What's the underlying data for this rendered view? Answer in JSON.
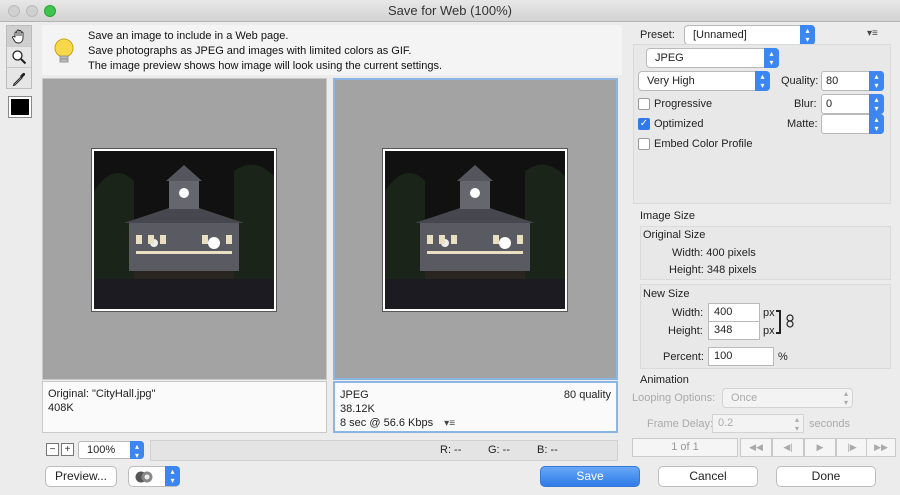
{
  "window": {
    "title": "Save for Web (100%)"
  },
  "colors": {
    "accent": "#2f7ae8",
    "pane_bg": "#a3a3a3",
    "selected_border": "#8db5e3"
  },
  "tools": [
    "hand-icon",
    "zoom-icon",
    "eyedropper-icon"
  ],
  "tip": {
    "lines": [
      "Save an image to include in a Web page.",
      "Save photographs as JPEG and images with limited colors as GIF.",
      "The image preview shows how image will look using the current settings."
    ]
  },
  "original_pane": {
    "name": "Original: \"CityHall.jpg\"",
    "size": "408K"
  },
  "optimized_pane": {
    "format": "JPEG",
    "quality_text": "80 quality",
    "size": "38.12K",
    "download": "8 sec @ 56.6 Kbps"
  },
  "bottom": {
    "zoom": "100%",
    "r": "R: --",
    "g": "G: --",
    "b": "B: --"
  },
  "buttons": {
    "preview": "Preview...",
    "save": "Save",
    "cancel": "Cancel",
    "done": "Done"
  },
  "preset": {
    "label": "Preset:",
    "value": "[Unnamed]"
  },
  "format": {
    "value": "JPEG"
  },
  "quality_level": {
    "value": "Very High"
  },
  "quality": {
    "label": "Quality:",
    "value": "80"
  },
  "blur": {
    "label": "Blur:",
    "value": "0"
  },
  "matte": {
    "label": "Matte:",
    "value": ""
  },
  "options": {
    "progressive": {
      "label": "Progressive",
      "checked": false
    },
    "optimized": {
      "label": "Optimized",
      "checked": true
    },
    "embed": {
      "label": "Embed Color Profile",
      "checked": false
    }
  },
  "image_size": {
    "heading": "Image Size",
    "original_heading": "Original Size",
    "orig_width": "Width:  400 pixels",
    "orig_height": "Height:  348 pixels",
    "new_heading": "New Size",
    "width_label": "Width:",
    "width_value": "400",
    "height_label": "Height:",
    "height_value": "348",
    "unit": "px",
    "percent_label": "Percent:",
    "percent_value": "100",
    "percent_unit": "%"
  },
  "animation": {
    "heading": "Animation",
    "looping_label": "Looping Options:",
    "looping_value": "Once",
    "delay_label": "Frame Delay:",
    "delay_value": "0.2",
    "delay_unit": "seconds",
    "frame_counter": "1 of 1"
  }
}
